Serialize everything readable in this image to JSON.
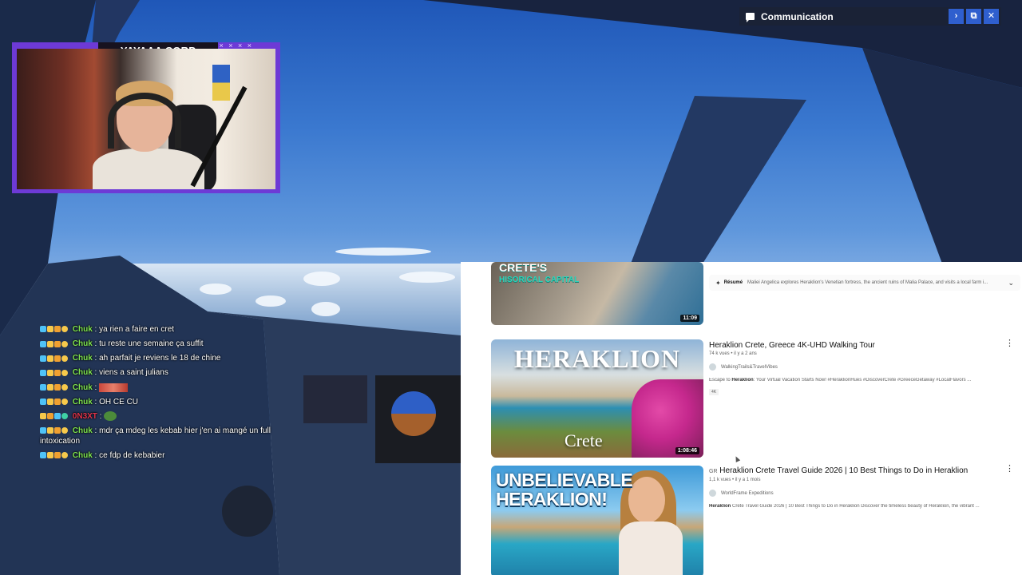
{
  "stream_overlay": {
    "webcam": {
      "title": "YAYAAA CORP",
      "decor": "× × × ×"
    }
  },
  "chat": {
    "messages": [
      {
        "user": "Chuk",
        "user_color": "#7ee34f",
        "text": "ya rien a faire en cret"
      },
      {
        "user": "Chuk",
        "user_color": "#7ee34f",
        "text": "tu reste une semaine ça suffit"
      },
      {
        "user": "Chuk",
        "user_color": "#7ee34f",
        "text": "ah parfait je reviens le 18 de chine"
      },
      {
        "user": "Chuk",
        "user_color": "#7ee34f",
        "text": "viens a saint julians"
      },
      {
        "user": "Chuk",
        "user_color": "#7ee34f",
        "text": "",
        "emote": "emote"
      },
      {
        "user": "Chuk",
        "user_color": "#7ee34f",
        "text": "OH CE CU"
      },
      {
        "user": "0N3XT",
        "user_color": "#e0334a",
        "text": "",
        "emote": "emote"
      },
      {
        "user": "Chuk",
        "user_color": "#7ee34f",
        "text": "mdr ça mdeg les kebab hier j'en ai mangé un full intoxication"
      },
      {
        "user": "Chuk",
        "user_color": "#7ee34f",
        "text": "ce fdp de kebabier"
      }
    ]
  },
  "communication_panel": {
    "icon": "chat-bubble-icon",
    "title": "Communication",
    "buttons": [
      {
        "name": "expand",
        "glyph": "›"
      },
      {
        "name": "popout",
        "glyph": "⧉"
      },
      {
        "name": "close",
        "glyph": "✕"
      }
    ],
    "accent": "#2f5fce"
  },
  "youtube": {
    "videos": [
      {
        "thumb_text": "CRETE'S",
        "thumb_text2": "HISORICAL CAPITAL",
        "duration": "11:09",
        "summary_label": "Résumé",
        "summary": "Maliei Angelica explores Heraklion's Venetian fortress, the ancient ruins of Malia Palace, and visits a local farm i..."
      },
      {
        "thumb_title": "HERAKLION",
        "thumb_sub": "Crete",
        "duration": "1:08:46",
        "title": "Heraklion Crete, Greece 4K-UHD Walking Tour",
        "meta": "74 k vues • il y a 2 ans",
        "channel": "WalkingTrails&TravelVibes",
        "desc_prefix": "Escape to ",
        "desc_bold": "Heraklion",
        "desc_rest": ": Your Virtual Vacation Starts Now! #HeraklionHues #DiscoverCrete #GreeceGetaway #LocalFlavors ...",
        "badge": "4K"
      },
      {
        "thumb_title": "UNBELIEVABLE HERAKLION!",
        "flag": "GR",
        "title": "Heraklion Crete Travel Guide 2026 | 10 Best Things to Do in Heraklion",
        "meta": "1,1 k vues • il y a 1 mois",
        "channel": "WorldFrame Expeditions",
        "desc_bold": "Heraklion",
        "desc_rest": " Crete Travel Guide 2026 | 10 Best Things to Do in Heraklion Discover the timeless beauty of Heraklion, the vibrant ..."
      }
    ],
    "more_icon": "⋮"
  }
}
